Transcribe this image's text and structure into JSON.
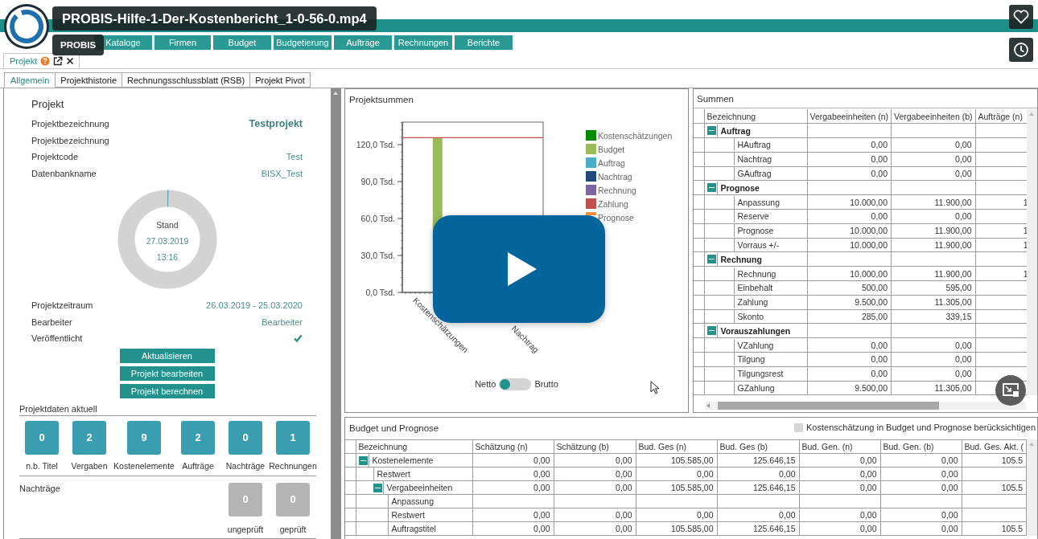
{
  "video": {
    "title": "PROBIS-Hilfe-1-Der-Kostenbericht_1-0-56-0.mp4",
    "byline": "PROBIS"
  },
  "nav": [
    {
      "label": "Kataloge",
      "kind": "plain"
    },
    {
      "label": "Firmen",
      "kind": "plain"
    },
    {
      "label": "Budget",
      "kind": "plain"
    },
    {
      "label": "Budgetierung",
      "kind": "plain"
    },
    {
      "label": "Aufträge",
      "kind": "plain"
    },
    {
      "label": "Rechnungen",
      "kind": "plain"
    },
    {
      "label": "Berichte",
      "kind": "plain"
    }
  ],
  "doc_tab": {
    "label": "Projekt"
  },
  "subtabs": [
    {
      "label": "Allgemein",
      "selected": true
    },
    {
      "label": "Projekthistorie",
      "selected": false
    },
    {
      "label": "Rechnungsschlussblatt (RSB)",
      "selected": false
    },
    {
      "label": "Projekt Pivot",
      "selected": false
    }
  ],
  "project": {
    "heading": "Projekt",
    "fields": [
      {
        "label": "Projektbezeichnung",
        "value": "Testprojekt",
        "kind": "title"
      },
      {
        "label": "Projektbezeichnung",
        "kind": "text"
      },
      {
        "label": "Projektcode",
        "value": "Test",
        "kind": "text"
      },
      {
        "label": "Datenbankname",
        "value": "BISX_Test",
        "kind": "text"
      }
    ],
    "status": {
      "label": "Stand",
      "date": "27.03.2019",
      "time": "13:16",
      "level": 0.004
    },
    "fields2": [
      {
        "label": "Projektzeitraum",
        "value": "26.03.2019 - 25.03.2020",
        "kind": "text"
      },
      {
        "label": "Bearbeiter",
        "value": "Bearbeiter",
        "kind": "text"
      },
      {
        "label": "Veröffentlicht",
        "kind": "checkbox",
        "checked": true
      }
    ],
    "buttons": [
      "Aktualisieren",
      "Projekt bearbeiten",
      "Projekt berechnen"
    ]
  },
  "project_data": {
    "title": "Projektdaten aktuell",
    "tiles": [
      {
        "value": "0",
        "label": "n.b. Titel",
        "disabled": false
      },
      {
        "value": "2",
        "label": "Vergaben",
        "disabled": false
      },
      {
        "value": "9",
        "label": "Kostenelemente",
        "disabled": false
      },
      {
        "value": "2",
        "label": "Aufträge",
        "disabled": false
      },
      {
        "value": "0",
        "label": "Nachträge",
        "disabled": false
      },
      {
        "value": "1",
        "label": "Rechnungen",
        "disabled": false
      }
    ]
  },
  "supplements": {
    "title": "Nachträge",
    "tiles": [
      {
        "value": "0",
        "label": "ungeprüft",
        "disabled": true
      },
      {
        "value": "0",
        "label": "geprüft",
        "disabled": true
      }
    ]
  },
  "chart_panel": {
    "title": "Projektsummen",
    "chart_data": {
      "type": "bar",
      "stacked": true,
      "categories": [
        "Kostenschätzungen",
        "Nachtrag"
      ],
      "ylim": [
        0,
        138.3
      ],
      "yticks": [
        {
          "value": 0,
          "label": "0,0 Tsd."
        },
        {
          "value": 30,
          "label": "30,0 Tsd."
        },
        {
          "value": 60,
          "label": "60,0 Tsd."
        },
        {
          "value": 90,
          "label": "90,0 Tsd."
        },
        {
          "value": 120,
          "label": "120,0 Tsd."
        }
      ],
      "series": [
        {
          "name": "Kostenschätzungen",
          "color": "#008a00",
          "values": [
            null,
            null
          ]
        },
        {
          "name": "Budget",
          "color": "#9bbb59",
          "values": [
            125.6,
            null
          ]
        },
        {
          "name": "Auftrag",
          "color": "#4bacc6",
          "values": [
            null,
            null
          ]
        },
        {
          "name": "Nachtrag",
          "color": "#1f497d",
          "values": [
            null,
            null
          ]
        },
        {
          "name": "Rechnung",
          "color": "#8064a2",
          "values": [
            null,
            null
          ]
        },
        {
          "name": "Zahlung",
          "color": "#c0504d",
          "values": [
            null,
            null
          ]
        },
        {
          "name": "Prognose",
          "color": "#f79646",
          "values": [
            null,
            null
          ]
        }
      ],
      "ref_lines": [
        {
          "axis": "y",
          "value": 125.6,
          "color": "#c0504d"
        }
      ]
    },
    "toggle": {
      "left": "Netto",
      "right": "Brutto",
      "on": false
    }
  },
  "sums": {
    "title": "Summen",
    "columns": [
      "Bezeichnung",
      "Vergabeeinheiten (n)",
      "Vergabeeinheiten (b)",
      "Aufträge (n)"
    ],
    "rows": [
      {
        "label": "Auftrag",
        "expanded": true,
        "children": [
          {
            "label": "HAuftrag",
            "values": [
              "0,00",
              "0,00"
            ]
          },
          {
            "label": "Nachtrag",
            "values": [
              "0,00",
              "0,00"
            ]
          },
          {
            "label": "GAuftrag",
            "values": [
              "0,00",
              "0,00"
            ]
          }
        ]
      },
      {
        "label": "Prognose",
        "expanded": true,
        "children": [
          {
            "label": "Anpassung",
            "values": [
              "10.000,00",
              "11.900,00",
              "1"
            ]
          },
          {
            "label": "Reserve",
            "values": [
              "0,00",
              "0,00"
            ]
          },
          {
            "label": "Prognose",
            "values": [
              "10.000,00",
              "11.900,00",
              "1"
            ]
          },
          {
            "label": "Vorraus +/-",
            "values": [
              "10.000,00",
              "11.900,00",
              "1"
            ]
          }
        ]
      },
      {
        "label": "Rechnung",
        "expanded": true,
        "children": [
          {
            "label": "Rechnung",
            "values": [
              "10.000,00",
              "11.900,00",
              "1"
            ]
          },
          {
            "label": "Einbehalt",
            "values": [
              "500,00",
              "595,00"
            ]
          },
          {
            "label": "Zahlung",
            "values": [
              "9.500,00",
              "11.305,00"
            ]
          },
          {
            "label": "Skonto",
            "values": [
              "285,00",
              "339,15"
            ]
          }
        ]
      },
      {
        "label": "Vorauszahlungen",
        "expanded": true,
        "children": [
          {
            "label": "VZahlung",
            "values": [
              "0,00",
              "0,00"
            ]
          },
          {
            "label": "Tilgung",
            "values": [
              "0,00",
              "0,00"
            ]
          },
          {
            "label": "Tilgungsrest",
            "values": [
              "0,00",
              "0,00"
            ]
          },
          {
            "label": "GZahlung",
            "values": [
              "9.500,00",
              "11.305,00"
            ]
          }
        ]
      }
    ]
  },
  "budget": {
    "title": "Budget und Prognose",
    "option": {
      "label": "Kostenschätzung in Budget und Prognose berücksichtigen",
      "checked": false
    },
    "columns": [
      "Bezeichnung",
      "Schätzung (n)",
      "Schätzung (b)",
      "Bud. Ges (n)",
      "Bud. Ges (b)",
      "Bud. Gen. (n)",
      "Bud. Gen. (b)",
      "Bud. Ges. Akt. ("
    ],
    "rows": [
      {
        "label": "Kostenelemente",
        "expanded": true,
        "values": [
          "0,00",
          "0,00",
          "105.585,00",
          "125.646,15",
          "0,00",
          "0,00",
          "105.5"
        ],
        "children": [
          {
            "label": "Restwert",
            "values": [
              "0,00",
              "0,00",
              "0,00",
              "0,00",
              "0,00",
              "0,00"
            ]
          },
          {
            "label": "Vergabeeinheiten",
            "expanded": true,
            "values": [
              "0,00",
              "0,00",
              "105.585,00",
              "125.646,15",
              "0,00",
              "0,00",
              "105.5"
            ],
            "children": [
              {
                "label": "Anpassung"
              },
              {
                "label": "Restwert",
                "values": [
                  "0,00",
                  "0,00",
                  "0,00",
                  "0,00",
                  "0,00",
                  "0,00"
                ]
              },
              {
                "label": "Auftragstitel",
                "values": [
                  "0,00",
                  "0,00",
                  "105.585,00",
                  "125.646,15",
                  "0,00",
                  "0,00",
                  "105.5"
                ]
              }
            ]
          }
        ]
      }
    ]
  }
}
